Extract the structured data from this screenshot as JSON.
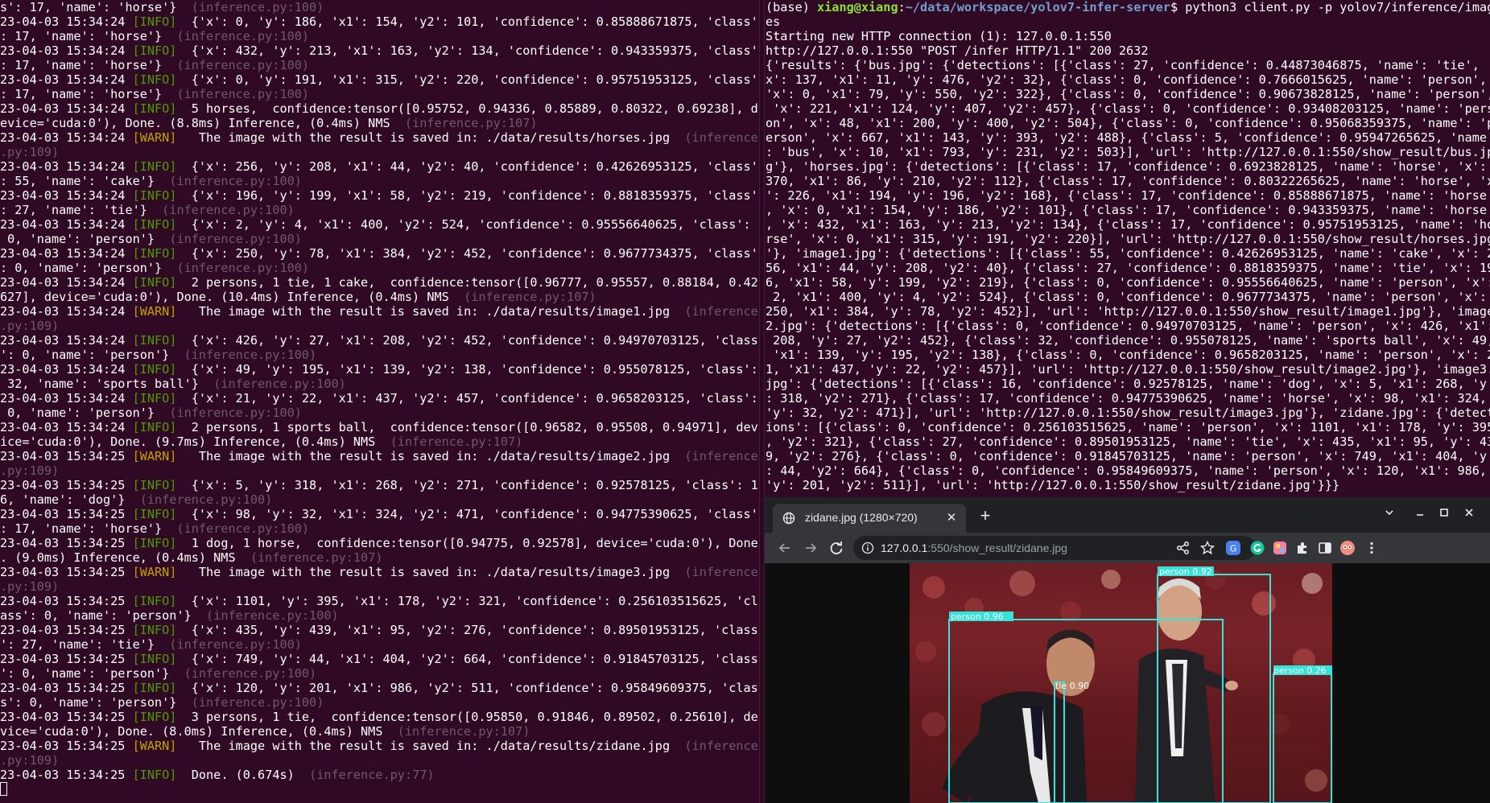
{
  "left_terminal": {
    "lines": [
      [
        [
          "s': 17, 'name': 'horse'}  ",
          "w"
        ],
        [
          "(inference.py:100)",
          "dim"
        ]
      ],
      [
        [
          "23-04-03 15:34:24 ",
          "w"
        ],
        [
          "[INFO]",
          "info"
        ],
        [
          "  {'x': 0, 'y': 186, 'x1': 154, 'y2': 101, 'confidence': 0.85888671875, 'class'",
          "w"
        ]
      ],
      [
        [
          ": 17, 'name': 'horse'}  ",
          "w"
        ],
        [
          "(inference.py:100)",
          "dim"
        ]
      ],
      [
        [
          "23-04-03 15:34:24 ",
          "w"
        ],
        [
          "[INFO]",
          "info"
        ],
        [
          "  {'x': 432, 'y': 213, 'x1': 163, 'y2': 134, 'confidence': 0.943359375, 'class'",
          "w"
        ]
      ],
      [
        [
          ": 17, 'name': 'horse'}  ",
          "w"
        ],
        [
          "(inference.py:100)",
          "dim"
        ]
      ],
      [
        [
          "23-04-03 15:34:24 ",
          "w"
        ],
        [
          "[INFO]",
          "info"
        ],
        [
          "  {'x': 0, 'y': 191, 'x1': 315, 'y2': 220, 'confidence': 0.95751953125, 'class'",
          "w"
        ]
      ],
      [
        [
          ": 17, 'name': 'horse'}  ",
          "w"
        ],
        [
          "(inference.py:100)",
          "dim"
        ]
      ],
      [
        [
          "23-04-03 15:34:24 ",
          "w"
        ],
        [
          "[INFO]",
          "info"
        ],
        [
          "  5 horses,  confidence:tensor([0.95752, 0.94336, 0.85889, 0.80322, 0.69238], d",
          "w"
        ]
      ],
      [
        [
          "evice='cuda:0'), Done. (8.8ms) Inference, (0.4ms) NMS  ",
          "w"
        ],
        [
          "(inference.py:107)",
          "dim"
        ]
      ],
      [
        [
          "23-04-03 15:34:24 ",
          "w"
        ],
        [
          "[WARN]",
          "warn"
        ],
        [
          "   The image with the result is saved in: ./data/results/horses.jpg  ",
          "w"
        ],
        [
          "(inference",
          "dim"
        ]
      ],
      [
        [
          ".py:109)",
          "dim"
        ]
      ],
      [
        [
          "23-04-03 15:34:24 ",
          "w"
        ],
        [
          "[INFO]",
          "info"
        ],
        [
          "  {'x': 256, 'y': 208, 'x1': 44, 'y2': 40, 'confidence': 0.42626953125, 'class'",
          "w"
        ]
      ],
      [
        [
          ": 55, 'name': 'cake'}  ",
          "w"
        ],
        [
          "(inference.py:100)",
          "dim"
        ]
      ],
      [
        [
          "23-04-03 15:34:24 ",
          "w"
        ],
        [
          "[INFO]",
          "info"
        ],
        [
          "  {'x': 196, 'y': 199, 'x1': 58, 'y2': 219, 'confidence': 0.8818359375, 'class'",
          "w"
        ]
      ],
      [
        [
          ": 27, 'name': 'tie'}  ",
          "w"
        ],
        [
          "(inference.py:100)",
          "dim"
        ]
      ],
      [
        [
          "23-04-03 15:34:24 ",
          "w"
        ],
        [
          "[INFO]",
          "info"
        ],
        [
          "  {'x': 2, 'y': 4, 'x1': 400, 'y2': 524, 'confidence': 0.95556640625, 'class':",
          "w"
        ]
      ],
      [
        [
          " 0, 'name': 'person'}  ",
          "w"
        ],
        [
          "(inference.py:100)",
          "dim"
        ]
      ],
      [
        [
          "23-04-03 15:34:24 ",
          "w"
        ],
        [
          "[INFO]",
          "info"
        ],
        [
          "  {'x': 250, 'y': 78, 'x1': 384, 'y2': 452, 'confidence': 0.9677734375, 'class'",
          "w"
        ]
      ],
      [
        [
          ": 0, 'name': 'person'}  ",
          "w"
        ],
        [
          "(inference.py:100)",
          "dim"
        ]
      ],
      [
        [
          "23-04-03 15:34:24 ",
          "w"
        ],
        [
          "[INFO]",
          "info"
        ],
        [
          "  2 persons, 1 tie, 1 cake,  confidence:tensor([0.96777, 0.95557, 0.88184, 0.42",
          "w"
        ]
      ],
      [
        [
          "627], device='cuda:0'), Done. (10.4ms) Inference, (0.4ms) NMS  ",
          "w"
        ],
        [
          "(inference.py:107)",
          "dim"
        ]
      ],
      [
        [
          "23-04-03 15:34:24 ",
          "w"
        ],
        [
          "[WARN]",
          "warn"
        ],
        [
          "   The image with the result is saved in: ./data/results/image1.jpg  ",
          "w"
        ],
        [
          "(inference",
          "dim"
        ]
      ],
      [
        [
          ".py:109)",
          "dim"
        ]
      ],
      [
        [
          "23-04-03 15:34:24 ",
          "w"
        ],
        [
          "[INFO]",
          "info"
        ],
        [
          "  {'x': 426, 'y': 27, 'x1': 208, 'y2': 452, 'confidence': 0.94970703125, 'class",
          "w"
        ]
      ],
      [
        [
          "': 0, 'name': 'person'}  ",
          "w"
        ],
        [
          "(inference.py:100)",
          "dim"
        ]
      ],
      [
        [
          "23-04-03 15:34:24 ",
          "w"
        ],
        [
          "[INFO]",
          "info"
        ],
        [
          "  {'x': 49, 'y': 195, 'x1': 139, 'y2': 138, 'confidence': 0.955078125, 'class':",
          "w"
        ]
      ],
      [
        [
          " 32, 'name': 'sports ball'}  ",
          "w"
        ],
        [
          "(inference.py:100)",
          "dim"
        ]
      ],
      [
        [
          "23-04-03 15:34:24 ",
          "w"
        ],
        [
          "[INFO]",
          "info"
        ],
        [
          "  {'x': 21, 'y': 22, 'x1': 437, 'y2': 457, 'confidence': 0.9658203125, 'class':",
          "w"
        ]
      ],
      [
        [
          " 0, 'name': 'person'}  ",
          "w"
        ],
        [
          "(inference.py:100)",
          "dim"
        ]
      ],
      [
        [
          "23-04-03 15:34:24 ",
          "w"
        ],
        [
          "[INFO]",
          "info"
        ],
        [
          "  2 persons, 1 sports ball,  confidence:tensor([0.96582, 0.95508, 0.94971], dev",
          "w"
        ]
      ],
      [
        [
          "ice='cuda:0'), Done. (9.7ms) Inference, (0.4ms) NMS  ",
          "w"
        ],
        [
          "(inference.py:107)",
          "dim"
        ]
      ],
      [
        [
          "23-04-03 15:34:25 ",
          "w"
        ],
        [
          "[WARN]",
          "warn"
        ],
        [
          "   The image with the result is saved in: ./data/results/image2.jpg  ",
          "w"
        ],
        [
          "(inference",
          "dim"
        ]
      ],
      [
        [
          ".py:109)",
          "dim"
        ]
      ],
      [
        [
          "23-04-03 15:34:25 ",
          "w"
        ],
        [
          "[INFO]",
          "info"
        ],
        [
          "  {'x': 5, 'y': 318, 'x1': 268, 'y2': 271, 'confidence': 0.92578125, 'class': 1",
          "w"
        ]
      ],
      [
        [
          "6, 'name': 'dog'}  ",
          "w"
        ],
        [
          "(inference.py:100)",
          "dim"
        ]
      ],
      [
        [
          "23-04-03 15:34:25 ",
          "w"
        ],
        [
          "[INFO]",
          "info"
        ],
        [
          "  {'x': 98, 'y': 32, 'x1': 324, 'y2': 471, 'confidence': 0.94775390625, 'class'",
          "w"
        ]
      ],
      [
        [
          ": 17, 'name': 'horse'}  ",
          "w"
        ],
        [
          "(inference.py:100)",
          "dim"
        ]
      ],
      [
        [
          "23-04-03 15:34:25 ",
          "w"
        ],
        [
          "[INFO]",
          "info"
        ],
        [
          "  1 dog, 1 horse,  confidence:tensor([0.94775, 0.92578], device='cuda:0'), Done",
          "w"
        ]
      ],
      [
        [
          ". (9.0ms) Inference, (0.4ms) NMS  ",
          "w"
        ],
        [
          "(inference.py:107)",
          "dim"
        ]
      ],
      [
        [
          "23-04-03 15:34:25 ",
          "w"
        ],
        [
          "[WARN]",
          "warn"
        ],
        [
          "   The image with the result is saved in: ./data/results/image3.jpg  ",
          "w"
        ],
        [
          "(inference",
          "dim"
        ]
      ],
      [
        [
          ".py:109)",
          "dim"
        ]
      ],
      [
        [
          "23-04-03 15:34:25 ",
          "w"
        ],
        [
          "[INFO]",
          "info"
        ],
        [
          "  {'x': 1101, 'y': 395, 'x1': 178, 'y2': 321, 'confidence': 0.256103515625, 'cl",
          "w"
        ]
      ],
      [
        [
          "ass': 0, 'name': 'person'}  ",
          "w"
        ],
        [
          "(inference.py:100)",
          "dim"
        ]
      ],
      [
        [
          "23-04-03 15:34:25 ",
          "w"
        ],
        [
          "[INFO]",
          "info"
        ],
        [
          "  {'x': 435, 'y': 439, 'x1': 95, 'y2': 276, 'confidence': 0.89501953125, 'class",
          "w"
        ]
      ],
      [
        [
          "': 27, 'name': 'tie'}  ",
          "w"
        ],
        [
          "(inference.py:100)",
          "dim"
        ]
      ],
      [
        [
          "23-04-03 15:34:25 ",
          "w"
        ],
        [
          "[INFO]",
          "info"
        ],
        [
          "  {'x': 749, 'y': 44, 'x1': 404, 'y2': 664, 'confidence': 0.91845703125, 'class",
          "w"
        ]
      ],
      [
        [
          "': 0, 'name': 'person'}  ",
          "w"
        ],
        [
          "(inference.py:100)",
          "dim"
        ]
      ],
      [
        [
          "23-04-03 15:34:25 ",
          "w"
        ],
        [
          "[INFO]",
          "info"
        ],
        [
          "  {'x': 120, 'y': 201, 'x1': 986, 'y2': 511, 'confidence': 0.95849609375, 'clas",
          "w"
        ]
      ],
      [
        [
          "s': 0, 'name': 'person'}  ",
          "w"
        ],
        [
          "(inference.py:100)",
          "dim"
        ]
      ],
      [
        [
          "23-04-03 15:34:25 ",
          "w"
        ],
        [
          "[INFO]",
          "info"
        ],
        [
          "  3 persons, 1 tie,  confidence:tensor([0.95850, 0.91846, 0.89502, 0.25610], de",
          "w"
        ]
      ],
      [
        [
          "vice='cuda:0'), Done. (8.0ms) Inference, (0.4ms) NMS  ",
          "w"
        ],
        [
          "(inference.py:107)",
          "dim"
        ]
      ],
      [
        [
          "23-04-03 15:34:25 ",
          "w"
        ],
        [
          "[WARN]",
          "warn"
        ],
        [
          "   The image with the result is saved in: ./data/results/zidane.jpg  ",
          "w"
        ],
        [
          "(inference",
          "dim"
        ]
      ],
      [
        [
          ".py:109)",
          "dim"
        ]
      ],
      [
        [
          "23-04-03 15:34:25 ",
          "w"
        ],
        [
          "[INFO]",
          "info"
        ],
        [
          "  Done. (0.674s)  ",
          "w"
        ],
        [
          "(inference.py:77)",
          "dim"
        ]
      ]
    ]
  },
  "right_terminal": {
    "lines": [
      [
        [
          "(base) ",
          "w"
        ],
        [
          "xiang@xiang",
          "user"
        ],
        [
          ":",
          "w"
        ],
        [
          "~/data/workspace/yolov7-infer-server",
          "path"
        ],
        [
          "$ python3 client.py -p yolov7/inference/imag",
          "w"
        ]
      ],
      [
        [
          "es",
          "w"
        ]
      ],
      [
        [
          "Starting new HTTP connection (1): 127.0.0.1:550",
          "w"
        ]
      ],
      [
        [
          "http://127.0.0.1:550 \"POST /infer HTTP/1.1\" 200 2632",
          "w"
        ]
      ],
      [
        [
          "{'results': {'bus.jpg': {'detections': [{'class': 27, 'confidence': 0.44873046875, 'name': 'tie', '",
          "w"
        ]
      ],
      [
        [
          "x': 137, 'x1': 11, 'y': 476, 'y2': 32}, {'class': 0, 'confidence': 0.7666015625, 'name': 'person',",
          "w"
        ]
      ],
      [
        [
          "'x': 0, 'x1': 79, 'y': 550, 'y2': 322}, {'class': 0, 'confidence': 0.90673828125, 'name': 'person',",
          "w"
        ]
      ],
      [
        [
          " 'x': 221, 'x1': 124, 'y': 407, 'y2': 457}, {'class': 0, 'confidence': 0.93408203125, 'name': 'pers",
          "w"
        ]
      ],
      [
        [
          "on', 'x': 48, 'x1': 200, 'y': 400, 'y2': 504}, {'class': 0, 'confidence': 0.95068359375, 'name': 'p",
          "w"
        ]
      ],
      [
        [
          "erson', 'x': 667, 'x1': 143, 'y': 393, 'y2': 488}, {'class': 5, 'confidence': 0.95947265625, 'name'",
          "w"
        ]
      ],
      [
        [
          ": 'bus', 'x': 10, 'x1': 793, 'y': 231, 'y2': 503}], 'url': 'http://127.0.0.1:550/show_result/bus.jp",
          "w"
        ]
      ],
      [
        [
          "g'}, 'horses.jpg': {'detections': [{'class': 17, 'confidence': 0.6923828125, 'name': 'horse', 'x':",
          "w"
        ]
      ],
      [
        [
          "370, 'x1': 86, 'y': 210, 'y2': 112}, {'class': 17, 'confidence': 0.80322265625, 'name': 'horse', 'x",
          "w"
        ]
      ],
      [
        [
          "': 226, 'x1': 194, 'y': 196, 'y2': 168}, {'class': 17, 'confidence': 0.85888671875, 'name': 'horse'",
          "w"
        ]
      ],
      [
        [
          ", 'x': 0, 'x1': 154, 'y': 186, 'y2': 101}, {'class': 17, 'confidence': 0.943359375, 'name': 'horse'",
          "w"
        ]
      ],
      [
        [
          ", 'x': 432, 'x1': 163, 'y': 213, 'y2': 134}, {'class': 17, 'confidence': 0.95751953125, 'name': 'ho",
          "w"
        ]
      ],
      [
        [
          "rse', 'x': 0, 'x1': 315, 'y': 191, 'y2': 220}], 'url': 'http://127.0.0.1:550/show_result/horses.jpg",
          "w"
        ]
      ],
      [
        [
          "'}, 'image1.jpg': {'detections': [{'class': 55, 'confidence': 0.42626953125, 'name': 'cake', 'x': 2",
          "w"
        ]
      ],
      [
        [
          "56, 'x1': 44, 'y': 208, 'y2': 40}, {'class': 27, 'confidence': 0.8818359375, 'name': 'tie', 'x': 19",
          "w"
        ]
      ],
      [
        [
          "6, 'x1': 58, 'y': 199, 'y2': 219}, {'class': 0, 'confidence': 0.95556640625, 'name': 'person', 'x':",
          "w"
        ]
      ],
      [
        [
          " 2, 'x1': 400, 'y': 4, 'y2': 524}, {'class': 0, 'confidence': 0.9677734375, 'name': 'person', 'x':",
          "w"
        ]
      ],
      [
        [
          "250, 'x1': 384, 'y': 78, 'y2': 452}], 'url': 'http://127.0.0.1:550/show_result/image1.jpg'}, 'image",
          "w"
        ]
      ],
      [
        [
          "2.jpg': {'detections': [{'class': 0, 'confidence': 0.94970703125, 'name': 'person', 'x': 426, 'x1':",
          "w"
        ]
      ],
      [
        [
          " 208, 'y': 27, 'y2': 452}, {'class': 32, 'confidence': 0.955078125, 'name': 'sports ball', 'x': 49,",
          "w"
        ]
      ],
      [
        [
          " 'x1': 139, 'y': 195, 'y2': 138}, {'class': 0, 'confidence': 0.9658203125, 'name': 'person', 'x': 2",
          "w"
        ]
      ],
      [
        [
          "1, 'x1': 437, 'y': 22, 'y2': 457}], 'url': 'http://127.0.0.1:550/show_result/image2.jpg'}, 'image3.",
          "w"
        ]
      ],
      [
        [
          "jpg': {'detections': [{'class': 16, 'confidence': 0.92578125, 'name': 'dog', 'x': 5, 'x1': 268, 'y'",
          "w"
        ]
      ],
      [
        [
          ": 318, 'y2': 271}, {'class': 17, 'confidence': 0.94775390625, 'name': 'horse', 'x': 98, 'x1': 324,",
          "w"
        ]
      ],
      [
        [
          "'y': 32, 'y2': 471}], 'url': 'http://127.0.0.1:550/show_result/image3.jpg'}, 'zidane.jpg': {'detect",
          "w"
        ]
      ],
      [
        [
          "ions': [{'class': 0, 'confidence': 0.256103515625, 'name': 'person', 'x': 1101, 'x1': 178, 'y': 395",
          "w"
        ]
      ],
      [
        [
          ", 'y2': 321}, {'class': 27, 'confidence': 0.89501953125, 'name': 'tie', 'x': 435, 'x1': 95, 'y': 43",
          "w"
        ]
      ],
      [
        [
          "9, 'y2': 276}, {'class': 0, 'confidence': 0.91845703125, 'name': 'person', 'x': 749, 'x1': 404, 'y'",
          "w"
        ]
      ],
      [
        [
          ": 44, 'y2': 664}, {'class': 0, 'confidence': 0.95849609375, 'name': 'person', 'x': 120, 'x1': 986,",
          "w"
        ]
      ],
      [
        [
          "'y': 201, 'y2': 511}], 'url': 'http://127.0.0.1:550/show_result/zidane.jpg'}}}",
          "w"
        ]
      ]
    ]
  },
  "browser": {
    "tab_title": "zidane.jpg (1280×720)",
    "tab_close": "✕",
    "new_tab": "+",
    "url_host": "127.0.0.1",
    "url_path": ":550/show_result/zidane.jpg",
    "image_alt": "zidane.jpg",
    "detections": [
      {
        "label": "person 0.92"
      },
      {
        "label": "person 0.96"
      },
      {
        "label": "tie 0.90"
      },
      {
        "label": "person 0.26"
      }
    ],
    "colors": {
      "box": "#35e3d9",
      "tab_bg": "#35363a",
      "toolbar_bg": "#35363a",
      "strip_bg": "#202124",
      "terminal_bg": "#300a24",
      "info_green": "#4e9a06",
      "warn_yellow": "#c4a000"
    },
    "icons": [
      "globe-icon",
      "close-icon",
      "plus-icon",
      "chevron-down-icon",
      "minimize-icon",
      "maximize-icon",
      "window-close-icon",
      "back-arrow-icon",
      "forward-arrow-icon",
      "reload-icon",
      "info-icon",
      "share-icon",
      "star-icon",
      "translate-extension-icon",
      "grammarly-extension-icon",
      "color-extension-icon",
      "puzzle-icon",
      "sidebar-icon",
      "profile-avatar-icon",
      "kebab-menu-icon"
    ]
  }
}
